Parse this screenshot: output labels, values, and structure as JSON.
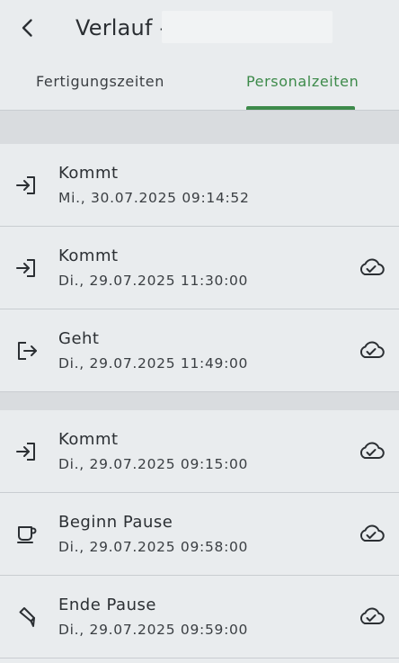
{
  "header": {
    "back_icon": "chevron-left-icon",
    "title": "Verlauf -",
    "title_field_value": ""
  },
  "tabs": [
    {
      "label": "Fertigungszeiten",
      "active": false
    },
    {
      "label": "Personalzeiten",
      "active": true
    }
  ],
  "colors": {
    "accent": "#3d8a4a",
    "background": "#e9ecee",
    "separator": "#d9dcdf"
  },
  "entries": [
    {
      "type": "Kommt",
      "timestamp": "Mi., 30.07.2025 09:14:52",
      "icon": "login-icon",
      "synced_icon": ""
    },
    {
      "type": "Kommt",
      "timestamp": "Di., 29.07.2025 11:30:00",
      "icon": "login-icon",
      "synced_icon": "cloud-done-icon"
    },
    {
      "type": "Geht",
      "timestamp": "Di., 29.07.2025 11:49:00",
      "icon": "logout-icon",
      "synced_icon": "cloud-done-icon"
    },
    {
      "type": "Kommt",
      "timestamp": "Di., 29.07.2025 09:15:00",
      "icon": "login-icon",
      "synced_icon": "cloud-done-icon"
    },
    {
      "type": "Beginn Pause",
      "timestamp": "Di., 29.07.2025 09:58:00",
      "icon": "coffee-cup-icon",
      "synced_icon": "cloud-done-icon"
    },
    {
      "type": "Ende Pause",
      "timestamp": "Di., 29.07.2025 09:59:00",
      "icon": "pause-end-icon",
      "synced_icon": "cloud-done-icon"
    }
  ]
}
